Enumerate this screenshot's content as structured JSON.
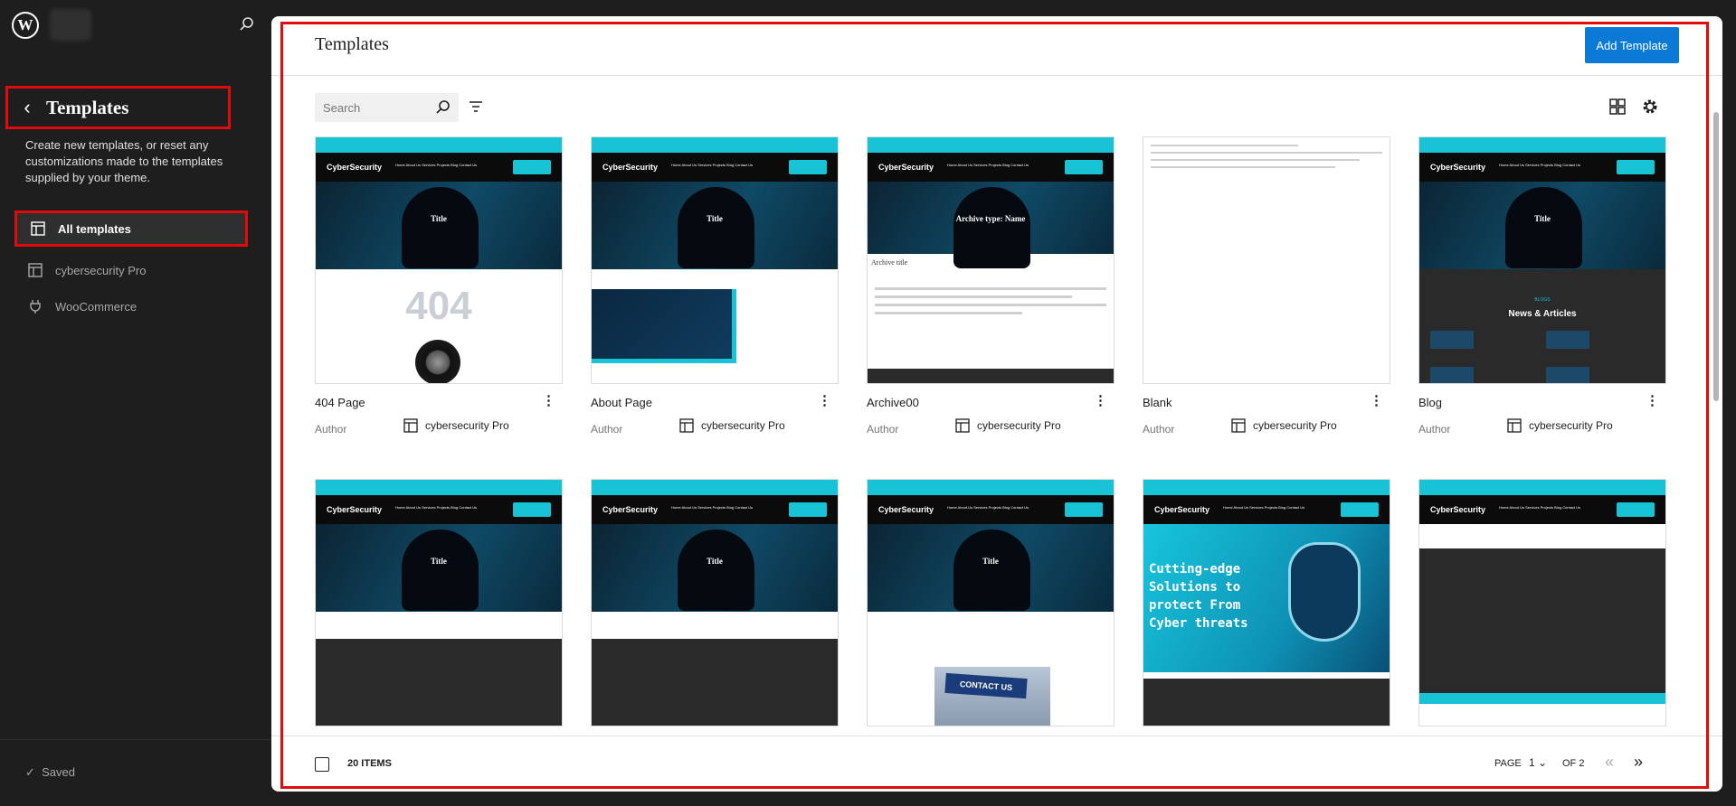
{
  "sidebar": {
    "logo_glyph": "W",
    "title": "Templates",
    "description": "Create new templates, or reset any customizations made to the templates supplied by your theme.",
    "items": [
      {
        "label": "All templates",
        "icon": "layout-icon",
        "active": true
      },
      {
        "label": "cybersecurity Pro",
        "icon": "layout-icon",
        "active": false
      },
      {
        "label": "WooCommerce",
        "icon": "plug-icon",
        "active": false
      }
    ],
    "status": "Saved",
    "status_check": "✓"
  },
  "header": {
    "title": "Templates",
    "add_button": "Add Template"
  },
  "toolbar": {
    "search_placeholder": "Search"
  },
  "templates": [
    {
      "name": "404 Page",
      "author_label": "Author",
      "theme": "cybersecurity Pro",
      "preview_text": {
        "hero": "Title",
        "big": "404"
      }
    },
    {
      "name": "About Page",
      "author_label": "Author",
      "theme": "cybersecurity Pro",
      "preview_text": {
        "hero": "Title"
      }
    },
    {
      "name": "Archive00",
      "author_label": "Author",
      "theme": "cybersecurity Pro",
      "preview_text": {
        "hero": "Archive type: Name",
        "sub": "Archive title"
      }
    },
    {
      "name": "Blank",
      "author_label": "Author",
      "theme": "cybersecurity Pro",
      "preview_text": {}
    },
    {
      "name": "Blog",
      "author_label": "Author",
      "theme": "cybersecurity Pro",
      "preview_text": {
        "hero": "Title",
        "eyebrow": "BLOGS",
        "section": "News & Articles"
      }
    },
    {
      "name": "",
      "author_label": "",
      "theme": "",
      "preview_text": {
        "hero": "Title"
      }
    },
    {
      "name": "",
      "author_label": "",
      "theme": "",
      "preview_text": {
        "hero": "Title"
      }
    },
    {
      "name": "",
      "author_label": "",
      "theme": "",
      "preview_text": {
        "hero": "Title",
        "sign": "CONTACT US"
      }
    },
    {
      "name": "",
      "author_label": "",
      "theme": "",
      "preview_text": {
        "hero": "Cutting-edge Solutions to protect From Cyber threats"
      }
    },
    {
      "name": "",
      "author_label": "",
      "theme": "",
      "preview_text": {}
    }
  ],
  "preview_common": {
    "logo": "CyberSecurity",
    "menu": "Home  About Us  Services  Projects  Blog  Contact Us"
  },
  "pagination": {
    "count": "20 ITEMS",
    "page_label": "PAGE",
    "current_page": "1",
    "of_label": "OF 2",
    "first_glyph": "«",
    "next_glyph": "»"
  },
  "colors": {
    "accent": "#0a7ad6",
    "highlight": "#e10b0b",
    "theme_cyan": "#18c3d6"
  }
}
